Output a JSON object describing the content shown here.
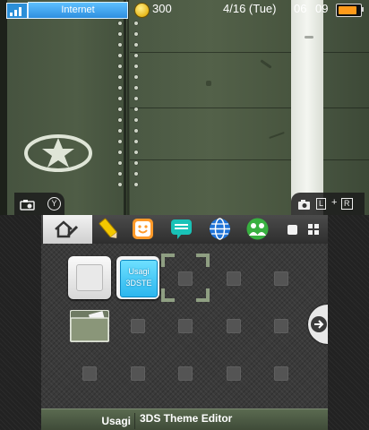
{
  "status_bar": {
    "connection_label": "Internet",
    "coin_count": "300",
    "date": "4/16 (Tue)",
    "time_hour": "06",
    "time_minute": "09",
    "battery_level": 0.85,
    "colors": {
      "connection": "#2e8fe0",
      "battery": "#ff9a1a"
    }
  },
  "top_screen": {
    "camera_left_hint": {
      "icon": "camera-icon",
      "button": "Y"
    },
    "camera_right_hint": {
      "icon": "camera-icon",
      "left_button": "L",
      "plus": "+",
      "right_button": "R"
    },
    "emblem": "star-emblem-icon"
  },
  "toolbar": {
    "settings_tab_icon": "home-settings-icon",
    "shortcuts": [
      {
        "name": "notes-pencil-icon",
        "color": "#f1c300"
      },
      {
        "name": "miiverse-face-icon",
        "color": "#ff9a2a"
      },
      {
        "name": "notifications-speech-icon",
        "color": "#19c2b7"
      },
      {
        "name": "browser-globe-icon",
        "color": "#1e73d8"
      },
      {
        "name": "friends-icon",
        "color": "#38b040"
      }
    ],
    "view_buttons": [
      "single-square-icon",
      "grid-squares-icon"
    ]
  },
  "home_grid": {
    "apps": [
      {
        "name": "white-square-app",
        "title": ""
      },
      {
        "name": "usagi-3dste-app",
        "line1": "Usagi",
        "line2": "3DSTE"
      }
    ],
    "folder_icon": "folder-icon"
  },
  "bottom_bar": {
    "user_name": "Usagi",
    "selected_title": "3DS Theme Editor"
  }
}
